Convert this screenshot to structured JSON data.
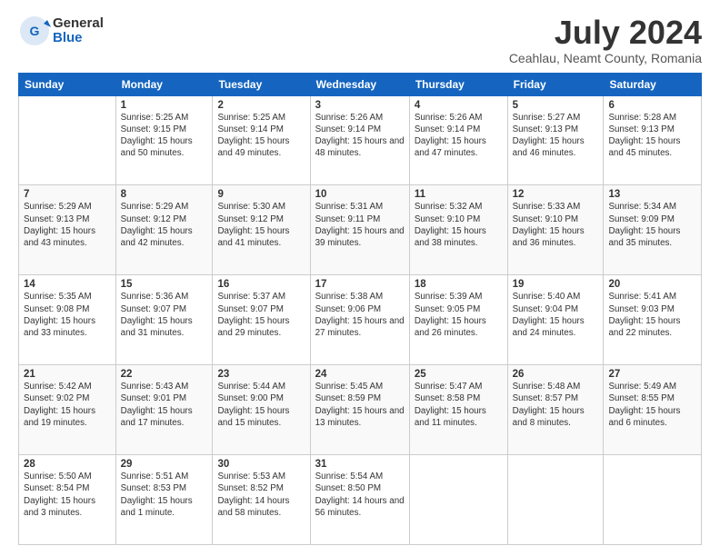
{
  "header": {
    "logo_general": "General",
    "logo_blue": "Blue",
    "month_title": "July 2024",
    "location": "Ceahlau, Neamt County, Romania"
  },
  "weekdays": [
    "Sunday",
    "Monday",
    "Tuesday",
    "Wednesday",
    "Thursday",
    "Friday",
    "Saturday"
  ],
  "weeks": [
    [
      {
        "day": "",
        "sunrise": "",
        "sunset": "",
        "daylight": ""
      },
      {
        "day": "1",
        "sunrise": "Sunrise: 5:25 AM",
        "sunset": "Sunset: 9:15 PM",
        "daylight": "Daylight: 15 hours and 50 minutes."
      },
      {
        "day": "2",
        "sunrise": "Sunrise: 5:25 AM",
        "sunset": "Sunset: 9:14 PM",
        "daylight": "Daylight: 15 hours and 49 minutes."
      },
      {
        "day": "3",
        "sunrise": "Sunrise: 5:26 AM",
        "sunset": "Sunset: 9:14 PM",
        "daylight": "Daylight: 15 hours and 48 minutes."
      },
      {
        "day": "4",
        "sunrise": "Sunrise: 5:26 AM",
        "sunset": "Sunset: 9:14 PM",
        "daylight": "Daylight: 15 hours and 47 minutes."
      },
      {
        "day": "5",
        "sunrise": "Sunrise: 5:27 AM",
        "sunset": "Sunset: 9:13 PM",
        "daylight": "Daylight: 15 hours and 46 minutes."
      },
      {
        "day": "6",
        "sunrise": "Sunrise: 5:28 AM",
        "sunset": "Sunset: 9:13 PM",
        "daylight": "Daylight: 15 hours and 45 minutes."
      }
    ],
    [
      {
        "day": "7",
        "sunrise": "Sunrise: 5:29 AM",
        "sunset": "Sunset: 9:13 PM",
        "daylight": "Daylight: 15 hours and 43 minutes."
      },
      {
        "day": "8",
        "sunrise": "Sunrise: 5:29 AM",
        "sunset": "Sunset: 9:12 PM",
        "daylight": "Daylight: 15 hours and 42 minutes."
      },
      {
        "day": "9",
        "sunrise": "Sunrise: 5:30 AM",
        "sunset": "Sunset: 9:12 PM",
        "daylight": "Daylight: 15 hours and 41 minutes."
      },
      {
        "day": "10",
        "sunrise": "Sunrise: 5:31 AM",
        "sunset": "Sunset: 9:11 PM",
        "daylight": "Daylight: 15 hours and 39 minutes."
      },
      {
        "day": "11",
        "sunrise": "Sunrise: 5:32 AM",
        "sunset": "Sunset: 9:10 PM",
        "daylight": "Daylight: 15 hours and 38 minutes."
      },
      {
        "day": "12",
        "sunrise": "Sunrise: 5:33 AM",
        "sunset": "Sunset: 9:10 PM",
        "daylight": "Daylight: 15 hours and 36 minutes."
      },
      {
        "day": "13",
        "sunrise": "Sunrise: 5:34 AM",
        "sunset": "Sunset: 9:09 PM",
        "daylight": "Daylight: 15 hours and 35 minutes."
      }
    ],
    [
      {
        "day": "14",
        "sunrise": "Sunrise: 5:35 AM",
        "sunset": "Sunset: 9:08 PM",
        "daylight": "Daylight: 15 hours and 33 minutes."
      },
      {
        "day": "15",
        "sunrise": "Sunrise: 5:36 AM",
        "sunset": "Sunset: 9:07 PM",
        "daylight": "Daylight: 15 hours and 31 minutes."
      },
      {
        "day": "16",
        "sunrise": "Sunrise: 5:37 AM",
        "sunset": "Sunset: 9:07 PM",
        "daylight": "Daylight: 15 hours and 29 minutes."
      },
      {
        "day": "17",
        "sunrise": "Sunrise: 5:38 AM",
        "sunset": "Sunset: 9:06 PM",
        "daylight": "Daylight: 15 hours and 27 minutes."
      },
      {
        "day": "18",
        "sunrise": "Sunrise: 5:39 AM",
        "sunset": "Sunset: 9:05 PM",
        "daylight": "Daylight: 15 hours and 26 minutes."
      },
      {
        "day": "19",
        "sunrise": "Sunrise: 5:40 AM",
        "sunset": "Sunset: 9:04 PM",
        "daylight": "Daylight: 15 hours and 24 minutes."
      },
      {
        "day": "20",
        "sunrise": "Sunrise: 5:41 AM",
        "sunset": "Sunset: 9:03 PM",
        "daylight": "Daylight: 15 hours and 22 minutes."
      }
    ],
    [
      {
        "day": "21",
        "sunrise": "Sunrise: 5:42 AM",
        "sunset": "Sunset: 9:02 PM",
        "daylight": "Daylight: 15 hours and 19 minutes."
      },
      {
        "day": "22",
        "sunrise": "Sunrise: 5:43 AM",
        "sunset": "Sunset: 9:01 PM",
        "daylight": "Daylight: 15 hours and 17 minutes."
      },
      {
        "day": "23",
        "sunrise": "Sunrise: 5:44 AM",
        "sunset": "Sunset: 9:00 PM",
        "daylight": "Daylight: 15 hours and 15 minutes."
      },
      {
        "day": "24",
        "sunrise": "Sunrise: 5:45 AM",
        "sunset": "Sunset: 8:59 PM",
        "daylight": "Daylight: 15 hours and 13 minutes."
      },
      {
        "day": "25",
        "sunrise": "Sunrise: 5:47 AM",
        "sunset": "Sunset: 8:58 PM",
        "daylight": "Daylight: 15 hours and 11 minutes."
      },
      {
        "day": "26",
        "sunrise": "Sunrise: 5:48 AM",
        "sunset": "Sunset: 8:57 PM",
        "daylight": "Daylight: 15 hours and 8 minutes."
      },
      {
        "day": "27",
        "sunrise": "Sunrise: 5:49 AM",
        "sunset": "Sunset: 8:55 PM",
        "daylight": "Daylight: 15 hours and 6 minutes."
      }
    ],
    [
      {
        "day": "28",
        "sunrise": "Sunrise: 5:50 AM",
        "sunset": "Sunset: 8:54 PM",
        "daylight": "Daylight: 15 hours and 3 minutes."
      },
      {
        "day": "29",
        "sunrise": "Sunrise: 5:51 AM",
        "sunset": "Sunset: 8:53 PM",
        "daylight": "Daylight: 15 hours and 1 minute."
      },
      {
        "day": "30",
        "sunrise": "Sunrise: 5:53 AM",
        "sunset": "Sunset: 8:52 PM",
        "daylight": "Daylight: 14 hours and 58 minutes."
      },
      {
        "day": "31",
        "sunrise": "Sunrise: 5:54 AM",
        "sunset": "Sunset: 8:50 PM",
        "daylight": "Daylight: 14 hours and 56 minutes."
      },
      {
        "day": "",
        "sunrise": "",
        "sunset": "",
        "daylight": ""
      },
      {
        "day": "",
        "sunrise": "",
        "sunset": "",
        "daylight": ""
      },
      {
        "day": "",
        "sunrise": "",
        "sunset": "",
        "daylight": ""
      }
    ]
  ]
}
